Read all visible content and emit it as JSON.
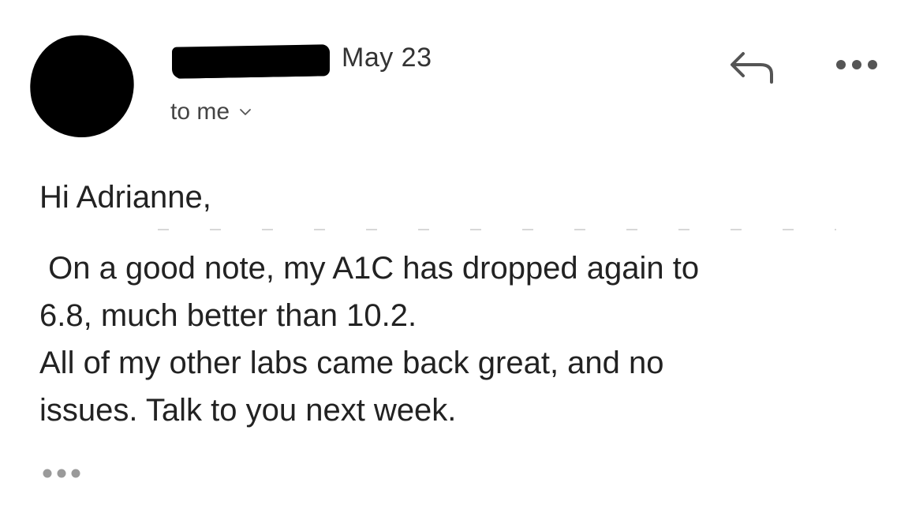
{
  "email": {
    "date": "May 23",
    "recipient_label": "to me",
    "greeting": "Hi Adrianne,",
    "paragraphs": [
      " On a good note, my A1C has dropped again to",
      "6.8, much better than 10.2.",
      "All of my other labs came back great, and no",
      "issues. Talk to you next week."
    ]
  },
  "icons": {
    "reply": "reply-icon",
    "more": "more-options-icon",
    "recipient_details": "chevron-down-icon",
    "expand_quoted": "ellipsis-icon"
  },
  "colors": {
    "text": "#222222",
    "muted": "#444444",
    "icon": "#555555",
    "redaction": "#000000"
  }
}
